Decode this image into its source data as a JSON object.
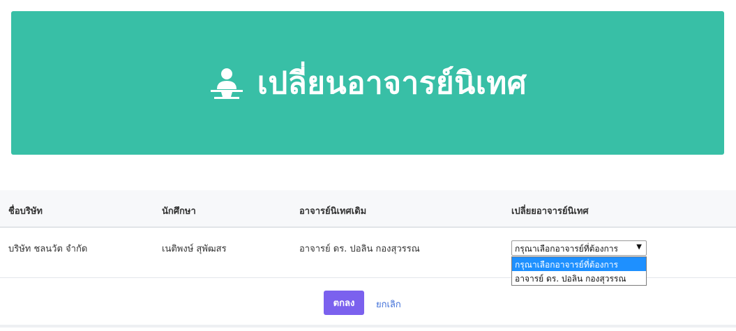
{
  "header": {
    "title": "เปลี่ยนอาจารย์นิเทศ",
    "icon": "user-teacher-icon"
  },
  "table": {
    "columns": [
      "ชื่อบริษัท",
      "นักศึกษา",
      "อาจารย์นิเทศเดิม",
      "เปลี่ยยอาจารย์นิเทศ"
    ],
    "row": {
      "company": "บริษัท ชลนวัต จำกัด",
      "student": "เนติพงษ์ สุพัฒสร",
      "old_advisor": "อาจารย์ ดร. ปอลิน กองสุวรรณ"
    }
  },
  "advisor_select": {
    "selected": "กรุณาเลือกอาจารย์ที่ต้องการ",
    "options": [
      "กรุณาเลือกอาจารย์ที่ต้องการ",
      "อาจารย์ ดร. ปอลิน กองสุวรรณ"
    ]
  },
  "actions": {
    "ok_label": "ตกลง",
    "cancel_label": "ยกเลิก"
  },
  "colors": {
    "banner": "#38bfa6",
    "primary_button": "#7b61ee",
    "link": "#3f6fd8",
    "selected_option": "#1e90ff"
  }
}
